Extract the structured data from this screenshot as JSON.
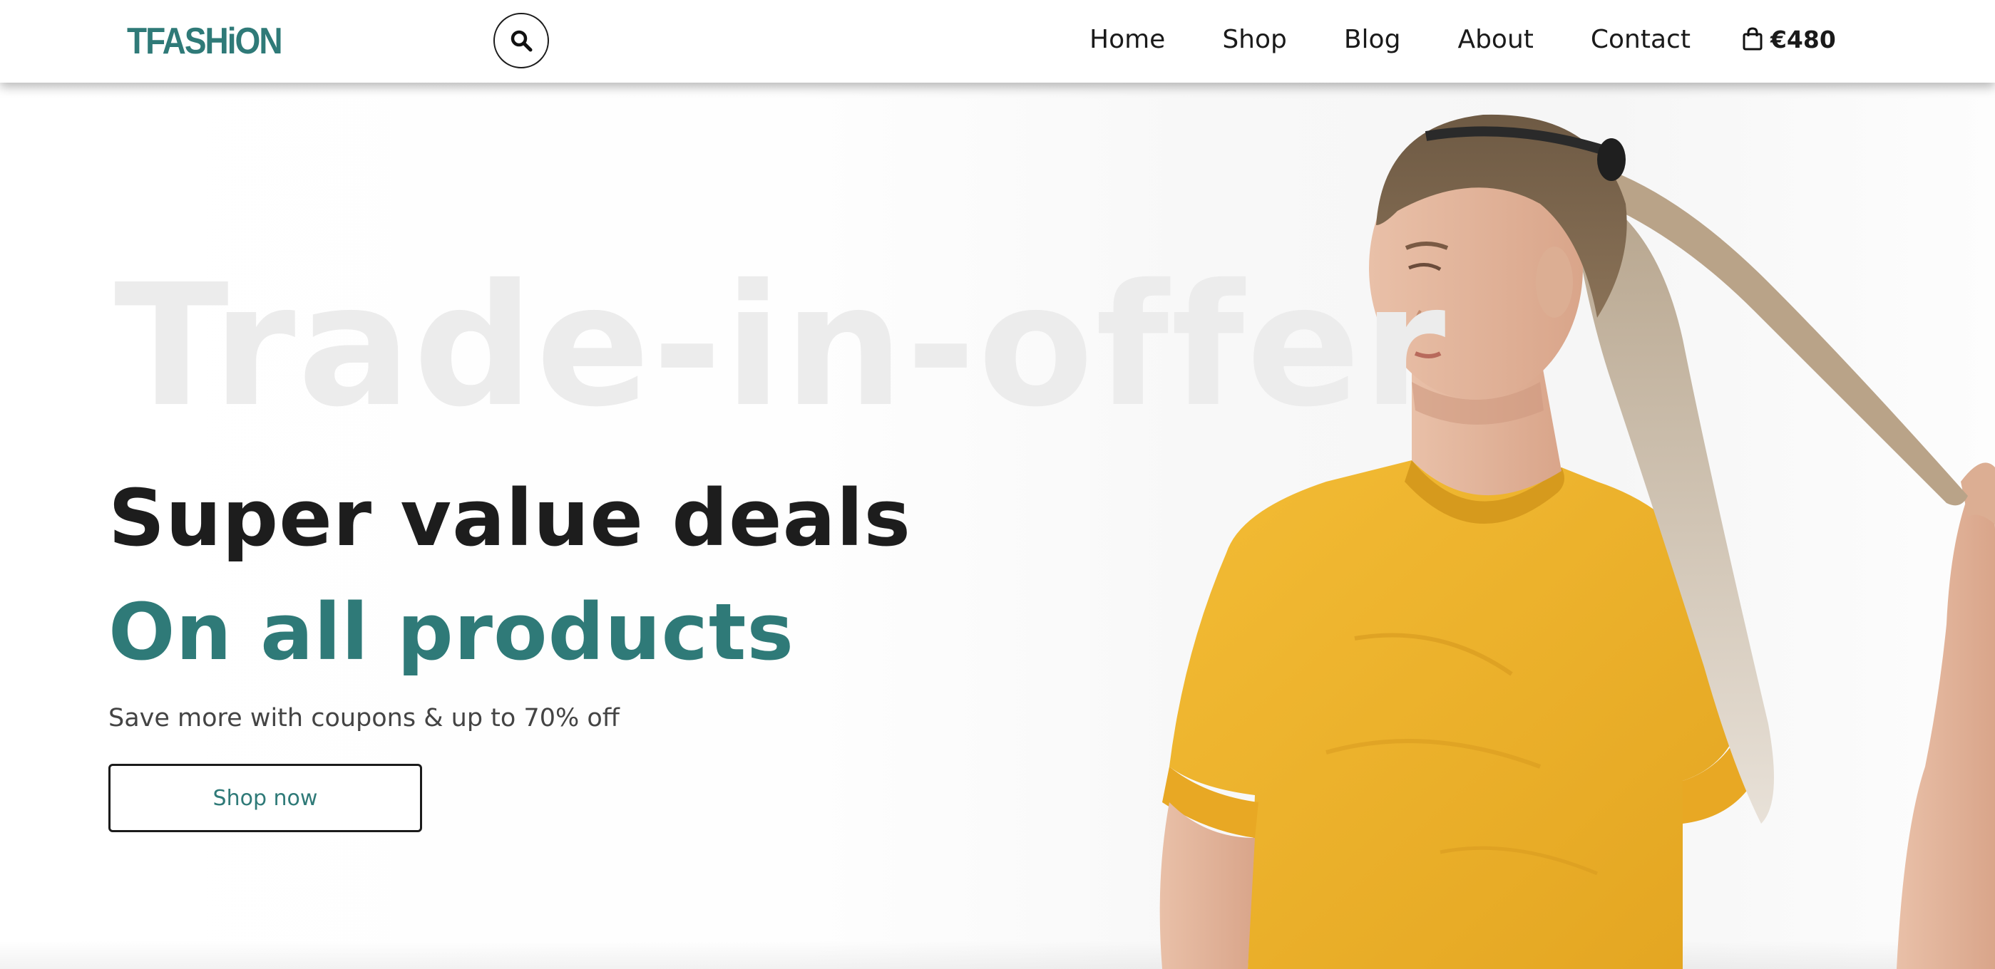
{
  "header": {
    "logo_text": "TFASHiON",
    "nav": [
      {
        "label": "Home"
      },
      {
        "label": "Shop"
      },
      {
        "label": "Blog"
      },
      {
        "label": "About"
      },
      {
        "label": "Contact"
      }
    ],
    "cart_total": "€480",
    "search_icon": "search-icon",
    "cart_icon": "shopping-bag-icon"
  },
  "hero": {
    "watermark": "Trade-in-offer",
    "headline": "Super value deals",
    "subheadline": "On all products",
    "tagline": "Save more with coupons & up to 70% off",
    "cta_label": "Shop now"
  },
  "colors": {
    "brand": "#2f7a78",
    "text_dark": "#1d1d1d",
    "watermark": "#ececec",
    "shirt": "#f2b632"
  }
}
